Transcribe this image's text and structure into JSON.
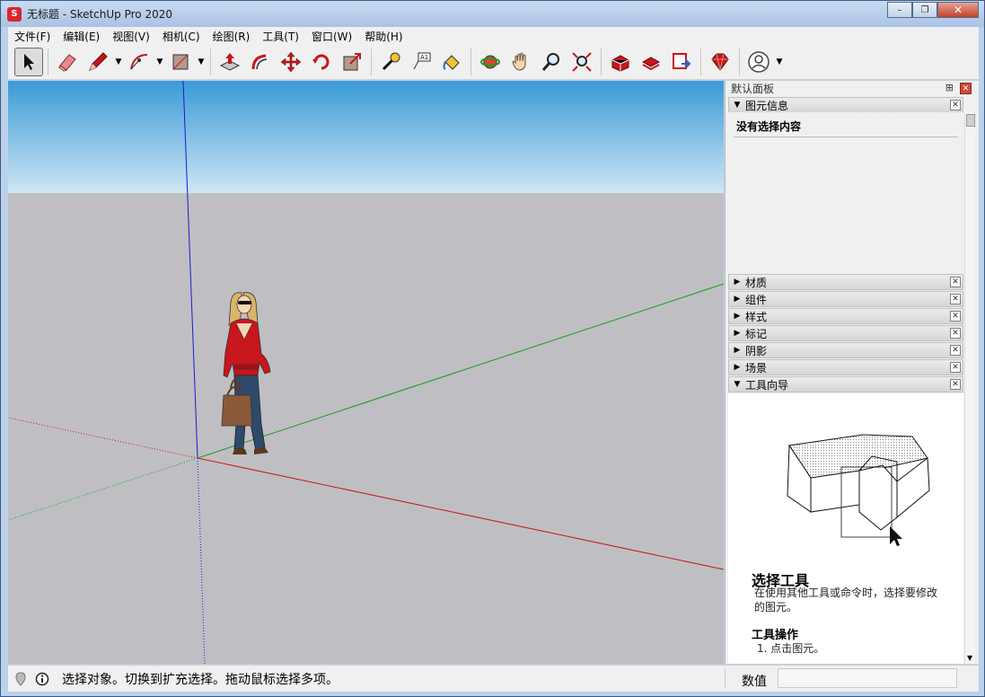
{
  "window": {
    "title": "无标题 - SketchUp Pro 2020",
    "controls": [
      "minimize",
      "restore",
      "close"
    ]
  },
  "menu": [
    "文件(F)",
    "编辑(E)",
    "视图(V)",
    "相机(C)",
    "绘图(R)",
    "工具(T)",
    "窗口(W)",
    "帮助(H)"
  ],
  "toolbar": {
    "tools": [
      {
        "id": "select",
        "icon": "select-arrow-icon",
        "active": true
      },
      {
        "id": "eraser",
        "icon": "eraser-icon"
      },
      {
        "id": "line",
        "icon": "pencil-icon",
        "dropdown": true
      },
      {
        "id": "arc",
        "icon": "arc-icon",
        "dropdown": true
      },
      {
        "id": "shape",
        "icon": "rectangle-icon",
        "dropdown": true
      },
      {
        "id": "push-pull",
        "icon": "push-pull-icon"
      },
      {
        "id": "offset",
        "icon": "offset-icon"
      },
      {
        "id": "move",
        "icon": "move-icon"
      },
      {
        "id": "rotate",
        "icon": "rotate-icon"
      },
      {
        "id": "scale",
        "icon": "scale-icon"
      },
      {
        "id": "tape",
        "icon": "tape-measure-icon"
      },
      {
        "id": "text",
        "icon": "text-label-icon"
      },
      {
        "id": "paint",
        "icon": "paint-bucket-icon"
      },
      {
        "id": "orbit",
        "icon": "orbit-icon"
      },
      {
        "id": "pan",
        "icon": "pan-hand-icon"
      },
      {
        "id": "zoom",
        "icon": "zoom-icon"
      },
      {
        "id": "zoom-extents",
        "icon": "zoom-extents-icon"
      },
      {
        "id": "3d-warehouse",
        "icon": "warehouse-icon"
      },
      {
        "id": "extension-warehouse",
        "icon": "extension-warehouse-icon"
      },
      {
        "id": "layout",
        "icon": "send-to-layout-icon"
      },
      {
        "id": "ruby",
        "icon": "ruby-icon"
      },
      {
        "id": "account",
        "icon": "account-icon",
        "dropdown": true
      }
    ]
  },
  "panel": {
    "title": "默认面板",
    "entity_info": {
      "label": "图元信息",
      "empty_text": "没有选择内容"
    },
    "trays": [
      "材质",
      "组件",
      "样式",
      "标记",
      "阴影",
      "场景",
      "工具向导"
    ],
    "guide": {
      "title": "选择工具",
      "description": "在使用其他工具或命令时，选择要修改的图元。",
      "ops_title": "工具操作",
      "step": "1. 点击图元。"
    }
  },
  "status": {
    "text": "选择对象。切换到扩充选择。拖动鼠标选择多项。",
    "measure_label": "数值",
    "measure_value": ""
  },
  "colors": {
    "sky_top": "#3a9ad6",
    "ground": "#bfbfc3",
    "axis_red": "#c8161d",
    "axis_green": "#1a9a1a",
    "axis_blue": "#1a1ad6"
  }
}
